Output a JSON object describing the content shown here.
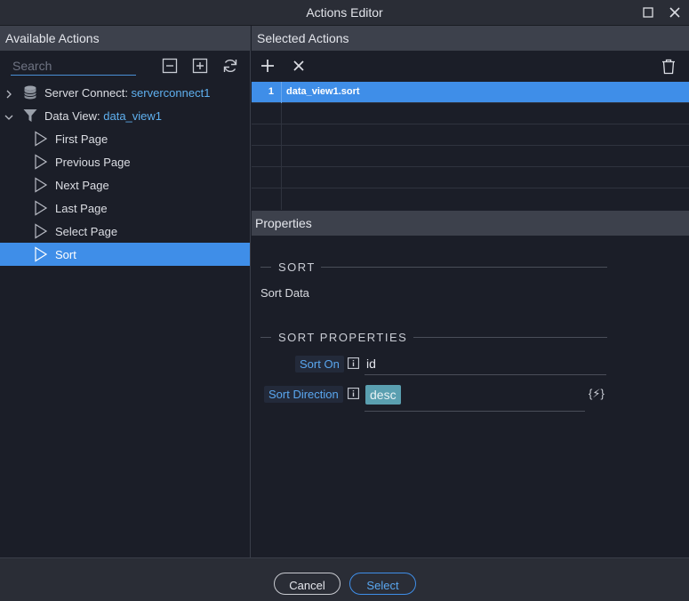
{
  "window": {
    "title": "Actions Editor"
  },
  "left": {
    "header": "Available Actions",
    "search_placeholder": "Search",
    "tree": {
      "server_connect": {
        "label": "Server Connect: ",
        "value": "serverconnect1"
      },
      "data_view": {
        "label": "Data View: ",
        "value": "data_view1"
      },
      "children": [
        {
          "label": "First Page"
        },
        {
          "label": "Previous Page"
        },
        {
          "label": "Next Page"
        },
        {
          "label": "Last Page"
        },
        {
          "label": "Select Page"
        },
        {
          "label": "Sort"
        }
      ]
    }
  },
  "right": {
    "header": "Selected Actions",
    "selected_rows": [
      {
        "num": "1",
        "action": "data_view1.sort"
      }
    ],
    "properties": {
      "header": "Properties",
      "section_sort": "SORT",
      "description": "Sort Data",
      "section_props": "SORT PROPERTIES",
      "sort_on_label": "Sort On",
      "sort_on_value": "id",
      "sort_direction_label": "Sort Direction",
      "sort_direction_value": "desc",
      "dynamic_icon_text": "{⚡}"
    }
  },
  "footer": {
    "cancel": "Cancel",
    "select": "Select"
  },
  "colors": {
    "accent": "#3f8ee8",
    "panel_header": "#3d414c",
    "background": "#1b1e28",
    "tag": "#5a9fb0"
  }
}
